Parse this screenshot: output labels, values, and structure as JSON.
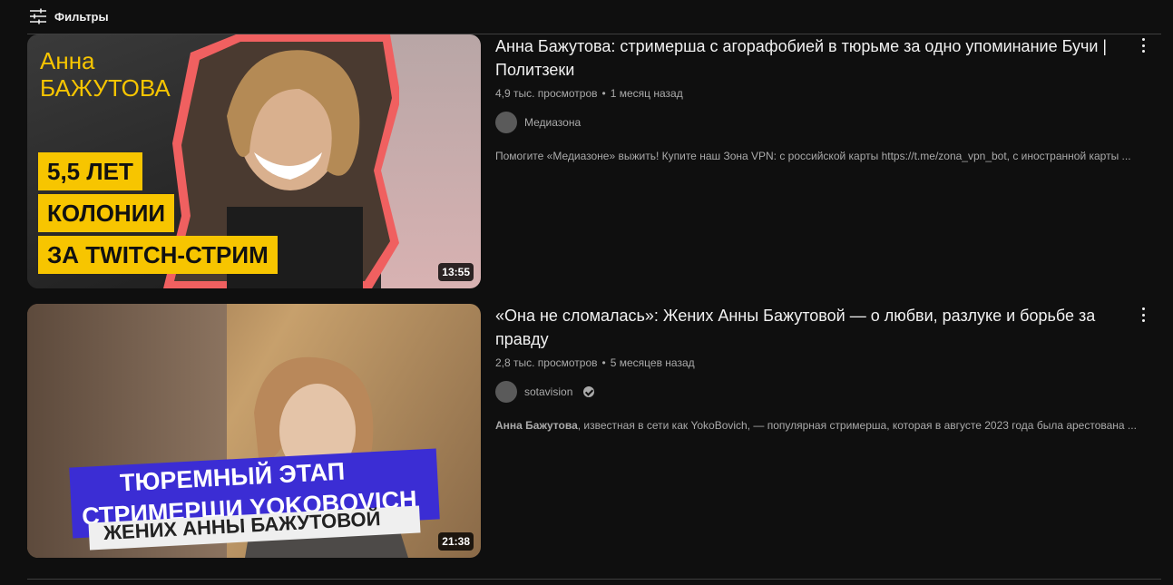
{
  "filters": {
    "label": "Фильтры",
    "icon": "filters-icon"
  },
  "results": [
    {
      "title": "Анна Бажутова: стримерша с агорафобией в тюрьме за одно упоминание Бучи | Политзеки",
      "views": "4,9 тыс. просмотров",
      "date": "1 месяц назад",
      "channel": "Медиазона",
      "verified": false,
      "description": "Помогите «Медиазоне» выжить! Купите наш Зона VPN: с российской карты https://t.me/zona_vpn_bot, с иностранной карты ...",
      "duration": "13:55",
      "thumbnail": {
        "name_lines": [
          "Анна",
          "БАЖУТОВА"
        ],
        "boxes": [
          "5,5 ЛЕТ",
          "КОЛОНИИ",
          "ЗА TWITCH-СТРИМ"
        ],
        "accent": "#f7c500",
        "outline": "#f06060"
      }
    },
    {
      "title": "«Она не сломалась»: Жених Анны Бажутовой — о любви, разлуке и борьбе за правду",
      "views": "2,8 тыс. просмотров",
      "date": "5 месяцев назад",
      "channel": "sotavision",
      "verified": true,
      "description_bold": "Анна Бажутова",
      "description": ", известная в сети как YokoBovich, — популярная стримерша, которая в августе 2023 года была арестована ...",
      "duration": "21:38",
      "thumbnail": {
        "banner_lines": [
          "ТЮРЕМНЫЙ ЭТАП",
          "СТРИМЕРШИ YOKOBOVICH"
        ],
        "subbanner": "ЖЕНИХ АННЫ БАЖУТОВОЙ",
        "accent": "#3b2dd4"
      }
    }
  ],
  "meta_separator": "•"
}
